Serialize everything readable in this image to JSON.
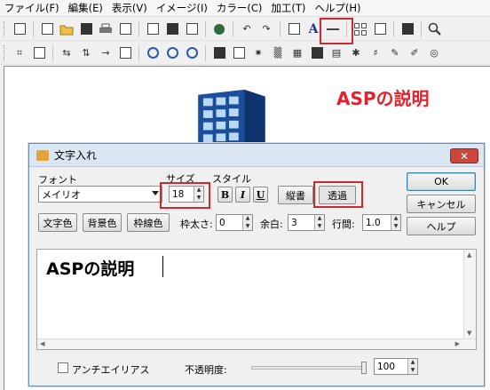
{
  "menu": [
    "ファイル(F)",
    "編集(E)",
    "表示(V)",
    "イメージ(I)",
    "カラー(C)",
    "加工(T)",
    "ヘルプ(H)"
  ],
  "canvas": {
    "title": "ASPの説明",
    "title_color": "#e8202a",
    "image_icon": "building-icon"
  },
  "dialog": {
    "title": "文字入れ",
    "close_label": "✕",
    "font_label": "フォント",
    "font_value": "メイリオ",
    "size_label": "サイズ",
    "size_value": "18",
    "style_label": "スタイル",
    "bold": "B",
    "italic": "I",
    "underline": "U",
    "vertical_btn": "縦書",
    "transparent_btn": "透過",
    "text_color_btn": "文字色",
    "bg_color_btn": "背景色",
    "border_color_btn": "枠線色",
    "border_width_label": "枠太さ:",
    "border_width_value": "0",
    "margin_label": "余白:",
    "margin_value": "3",
    "line_spacing_label": "行間:",
    "line_spacing_value": "1.0",
    "ok_btn": "OK",
    "cancel_btn": "キャンセル",
    "help_btn": "ヘルプ",
    "text_content": "ASPの説明",
    "antialias_label": "アンチエイリアス",
    "antialias_checked": false,
    "opacity_label": "不透明度:",
    "opacity_value": "100",
    "highlight_color": "#d0282e"
  }
}
